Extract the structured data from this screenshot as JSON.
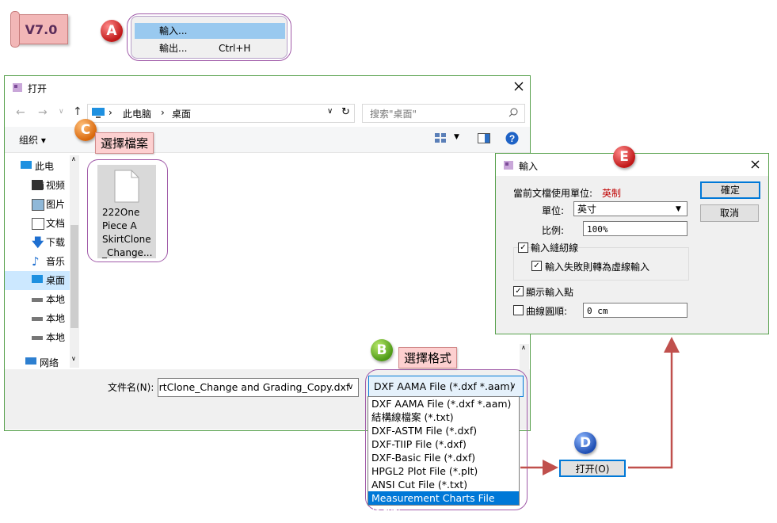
{
  "version_badge": "V7.0",
  "markers": {
    "a": "A",
    "b": "B",
    "c": "C",
    "d": "D",
    "e": "E"
  },
  "callouts": {
    "select_file": "選擇檔案",
    "select_format": "選擇格式"
  },
  "context_menu": {
    "items": [
      {
        "label": "輸入...",
        "shortcut": "",
        "highlighted": true
      },
      {
        "label": "輸出...",
        "shortcut": "Ctrl+H",
        "highlighted": false
      }
    ]
  },
  "open_dialog": {
    "title": "打开",
    "breadcrumb": [
      "此电脑",
      "桌面"
    ],
    "search_placeholder": "搜索\"桌面\"",
    "organize_label": "组织 ▾",
    "nav_items": [
      {
        "label": "此电脑",
        "icon": "computer-icon"
      },
      {
        "label": "视频",
        "icon": "video-icon"
      },
      {
        "label": "图片",
        "icon": "picture-icon"
      },
      {
        "label": "文档",
        "icon": "document-icon"
      },
      {
        "label": "下载",
        "icon": "download-icon"
      },
      {
        "label": "音乐",
        "icon": "music-icon"
      },
      {
        "label": "桌面",
        "icon": "desktop-icon"
      },
      {
        "label": "本地",
        "icon": "drive-icon"
      },
      {
        "label": "本地",
        "icon": "drive-icon"
      },
      {
        "label": "本地",
        "icon": "drive-icon"
      },
      {
        "label": "网络",
        "icon": "network-icon"
      }
    ],
    "file": {
      "name_lines": [
        "222One",
        "Piece A",
        "SkirtClone",
        "_Change..."
      ]
    },
    "filename_label": "文件名(N):",
    "filename_value": "SkirtClone_Change and Grading_Copy.dxf",
    "filetype_selected": "DXF AAMA File (*.dxf *.aam)",
    "filetype_options": [
      "DXF AAMA File (*.dxf *.aam)",
      "結構線檔案 (*.txt)",
      "DXF-ASTM File (*.dxf)",
      "DXF-TIIP File (*.dxf)",
      "DXF-Basic File (*.dxf)",
      "HPGL2 Plot File (*.plt)",
      "ANSI Cut File (*.txt)",
      "Measurement Charts File (*.txt)"
    ],
    "open_button": "打开(O)"
  },
  "import_dialog": {
    "title": "輸入",
    "unit_label": "當前文檔使用單位:",
    "unit_value": "英制",
    "unit_select_label": "單位:",
    "unit_select_value": "英寸",
    "scale_label": "比例:",
    "scale_value": "100%",
    "import_seam_label": "輸入縫紉線",
    "import_seam_checked": true,
    "fallback_label": "輸入失敗則轉為虛線輸入",
    "fallback_checked": true,
    "show_points_label": "顯示輸入點",
    "show_points_checked": true,
    "curve_smooth_label": "曲線圓順:",
    "curve_smooth_checked": false,
    "curve_smooth_value": "0 cm",
    "ok_button": "確定",
    "cancel_button": "取消"
  },
  "colors": {
    "accent": "#0078d7",
    "dialog_border": "#58a14d",
    "annotation_line": "#c0504d",
    "unit_red": "#c00000"
  }
}
